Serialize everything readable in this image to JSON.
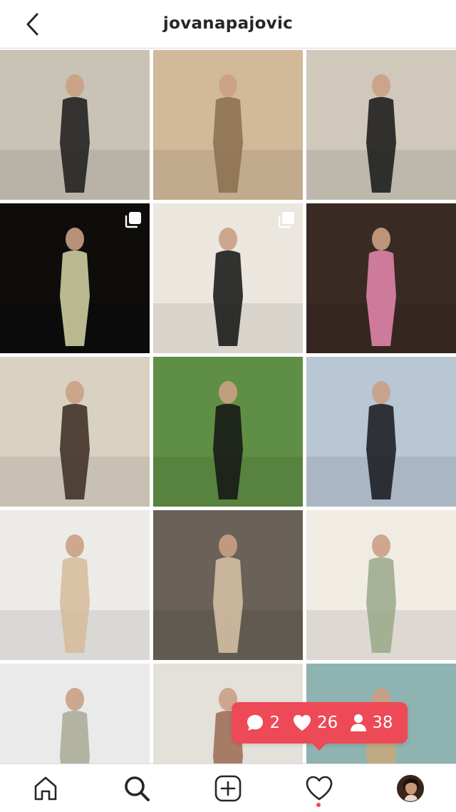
{
  "header": {
    "title": "jovanapajovic",
    "back_icon": "chevron-left-icon"
  },
  "grid": {
    "posts": [
      {
        "name": "post-staircase-black-skirt",
        "bg": "#c9c3b6",
        "accent": "#1a1a1a",
        "multi": false
      },
      {
        "name": "post-pool-interior",
        "bg": "#d2b99a",
        "accent": "#8a6e50",
        "multi": false
      },
      {
        "name": "post-staircase-black-dress",
        "bg": "#cfc8bb",
        "accent": "#151515",
        "multi": false
      },
      {
        "name": "post-cocktail-glasses",
        "bg": "#0e0d0c",
        "accent": "#d8d8a8",
        "multi": true
      },
      {
        "name": "post-black-cutout-dress",
        "bg": "#ebe6de",
        "accent": "#111111",
        "multi": true
      },
      {
        "name": "post-pink-top-graffiti",
        "bg": "#3a2a24",
        "accent": "#e98ab0",
        "multi": false
      },
      {
        "name": "post-bathroom-mirror",
        "bg": "#d9d1c2",
        "accent": "#3a2a20",
        "multi": false
      },
      {
        "name": "post-park-black-jumpsuit",
        "bg": "#5f8f44",
        "accent": "#141414",
        "multi": false
      },
      {
        "name": "post-harbour-black-pants",
        "bg": "#b9c6d4",
        "accent": "#15171c",
        "multi": false
      },
      {
        "name": "post-beige-top-seated",
        "bg": "#ecebe8",
        "accent": "#d6bb9a",
        "multi": false
      },
      {
        "name": "post-denim-skirt",
        "bg": "#6a6258",
        "accent": "#d9c4a8",
        "multi": false
      },
      {
        "name": "post-beach-green-bikini",
        "bg": "#f0ece4",
        "accent": "#9aa88a",
        "multi": false
      },
      {
        "name": "post-beach-striped-bikini",
        "bg": "#eaeaea",
        "accent": "#a8aa94",
        "multi": false
      },
      {
        "name": "post-brown-dress-stairs",
        "bg": "#e4e0da",
        "accent": "#9c6a52",
        "multi": false
      },
      {
        "name": "post-sea-view-wine",
        "bg": "#8fb3b0",
        "accent": "#c9a87c",
        "multi": false
      }
    ]
  },
  "activity": {
    "comments_count": "2",
    "likes_count": "26",
    "followers_count": "38",
    "comment_icon": "comment-bubble-icon",
    "like_icon": "heart-icon",
    "follower_icon": "person-icon",
    "color": "#ed4956"
  },
  "tabbar": {
    "tabs": [
      {
        "name": "tab-home",
        "icon": "home-icon"
      },
      {
        "name": "tab-search",
        "icon": "search-icon"
      },
      {
        "name": "tab-new-post",
        "icon": "plus-square-icon"
      },
      {
        "name": "tab-activity",
        "icon": "heart-icon"
      },
      {
        "name": "tab-profile",
        "icon": "avatar"
      }
    ]
  }
}
